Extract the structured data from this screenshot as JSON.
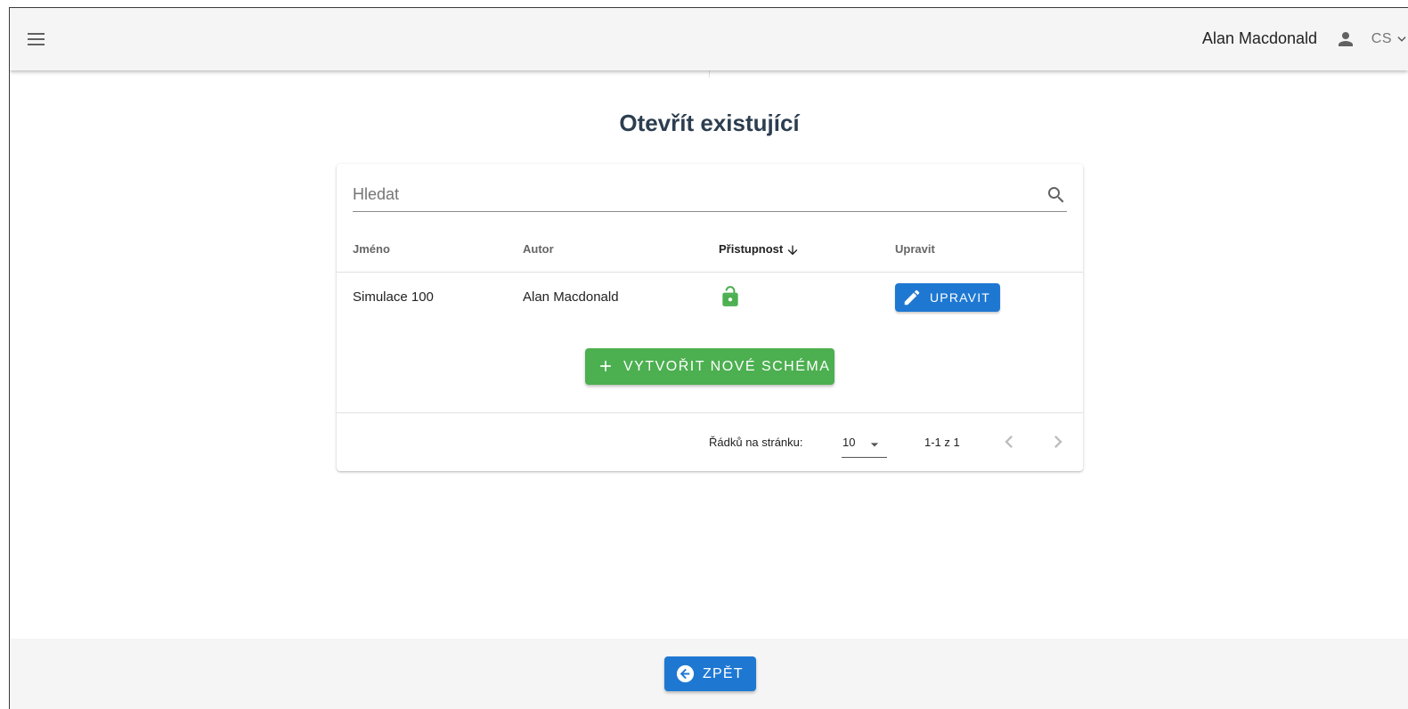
{
  "header": {
    "menu_icon": "hamburger-menu-icon",
    "user_name": "Alan Macdonald",
    "user_icon": "person-icon",
    "language": "CS"
  },
  "page": {
    "title": "Otevřít existující"
  },
  "search": {
    "placeholder": "Hledat",
    "value": "",
    "icon": "search-icon"
  },
  "table": {
    "columns": [
      "Jméno",
      "Autor",
      "Přistupnost",
      "Upravit"
    ],
    "sorted_column": "Přistupnost",
    "sort_direction": "descending",
    "rows": [
      {
        "name": "Simulace 100",
        "author": "Alan Macdonald",
        "access_icon": "lock-open-icon",
        "edit_label": "UPRAVIT"
      }
    ]
  },
  "actions": {
    "create_label": "VYTVOŘIT NOVÉ SCHÉMA"
  },
  "pagination": {
    "rows_per_page_label": "Řádků na stránku:",
    "rows_per_page": "10",
    "range": "1-1 z 1"
  },
  "footer": {
    "back_label": "ZPĚT"
  },
  "colors": {
    "primary": "#1e78d2",
    "success": "#4caf50",
    "title": "#2c3e50",
    "appbar": "#f5f5f5"
  }
}
